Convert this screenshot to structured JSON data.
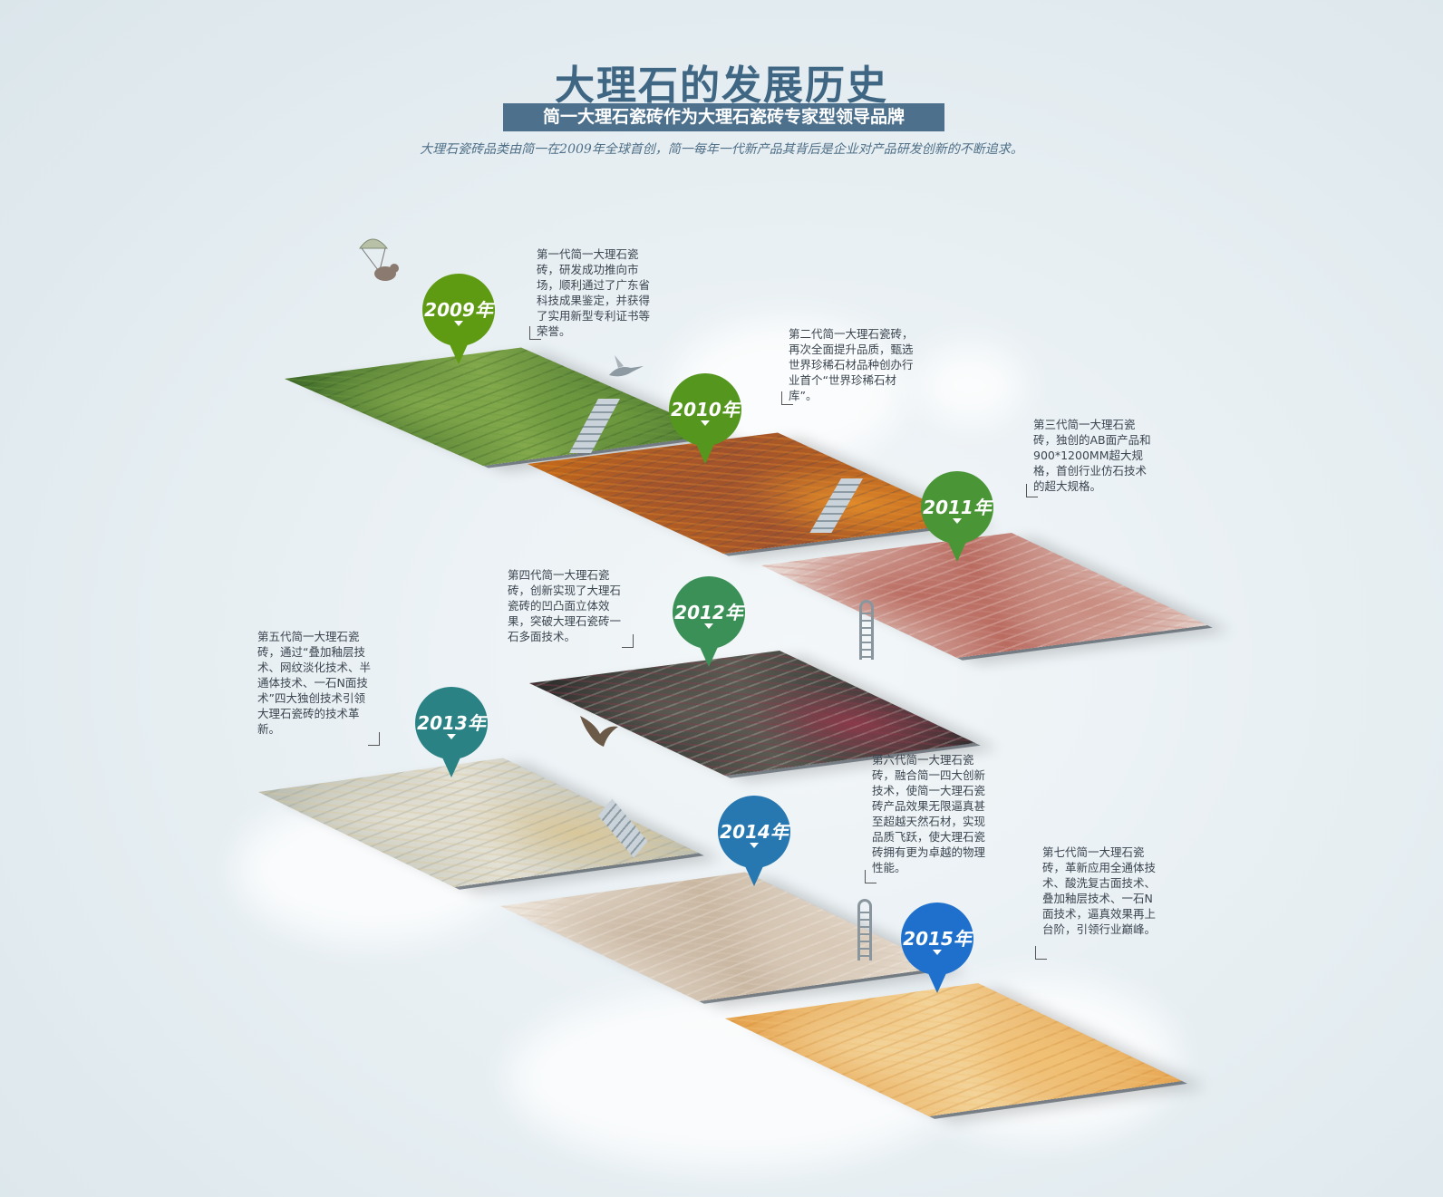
{
  "header": {
    "title": "大理石的发展历史",
    "subtitle": "简一大理石瓷砖作为大理石瓷砖专家型领导品牌",
    "intro": "大理石瓷砖品类由简一在2009年全球首创，简一每年一代新产品其背后是企业对产品研发创新的不断追求。"
  },
  "milestones": [
    {
      "year": "2009年",
      "color": "#5e9a12",
      "text": "第一代简一大理石瓷砖，研发成功推向市场，顺利通过了广东省科技成果鉴定，并获得了实用新型专利证书等荣誉。"
    },
    {
      "year": "2010年",
      "color": "#55961e",
      "text": "第二代简一大理石瓷砖，再次全面提升品质，甄选世界珍稀石材品种创办行业首个“世界珍稀石材库”。"
    },
    {
      "year": "2011年",
      "color": "#4a9636",
      "text": "第三代简一大理石瓷砖，独创的AB面产品和900*1200MM超大规格，首创行业仿石技术的超大规格。"
    },
    {
      "year": "2012年",
      "color": "#3a9056",
      "text": "第四代简一大理石瓷砖，创新实现了大理石瓷砖的凹凸面立体效果，突破大理石瓷砖一石多面技术。"
    },
    {
      "year": "2013年",
      "color": "#2a8284",
      "text": "第五代简一大理石瓷砖，通过“叠加釉层技术、网纹淡化技术、半通体技术、一石N面技术”四大独创技术引领大理石瓷砖的技术革新。"
    },
    {
      "year": "2014年",
      "color": "#2777b0",
      "text": "第六代简一大理石瓷砖，融合简一四大创新技术，使简一大理石瓷砖产品效果无限逼真甚至超越天然石材，实现品质飞跃，使大理石瓷砖拥有更为卓越的物理性能。"
    },
    {
      "year": "2015年",
      "color": "#1e70cc",
      "text": "第七代简一大理石瓷砖，革新应用全通体技术、酸洗复古面技术、叠加釉层技术、一石N面技术，逼真效果再上台阶，引领行业巅峰。"
    }
  ],
  "tiles": [
    {
      "name": "green-marble",
      "colors": [
        "#3f6b2a",
        "#6e9a3e",
        "#2f5220",
        "#83a94c"
      ]
    },
    {
      "name": "orange-marble",
      "colors": [
        "#c46a1a",
        "#e08a2a",
        "#5a4a44",
        "#a0522d"
      ]
    },
    {
      "name": "pink-marble",
      "colors": [
        "#e9dcd6",
        "#c98c80",
        "#f2e9e5",
        "#b96b60"
      ]
    },
    {
      "name": "dark-floral-marble",
      "colors": [
        "#2b2b2b",
        "#8a3a4a",
        "#d8d2c6",
        "#5a5a52"
      ]
    },
    {
      "name": "grey-gold-marble",
      "colors": [
        "#b9bcb0",
        "#d9c79a",
        "#8f9488",
        "#e3e0d4"
      ]
    },
    {
      "name": "cream-marble",
      "colors": [
        "#eee6dc",
        "#d8c8b6",
        "#f6f1ea",
        "#c9b7a2"
      ]
    },
    {
      "name": "golden-marble",
      "colors": [
        "#e4a04a",
        "#f0c074",
        "#c9842f",
        "#f3d399"
      ]
    }
  ]
}
